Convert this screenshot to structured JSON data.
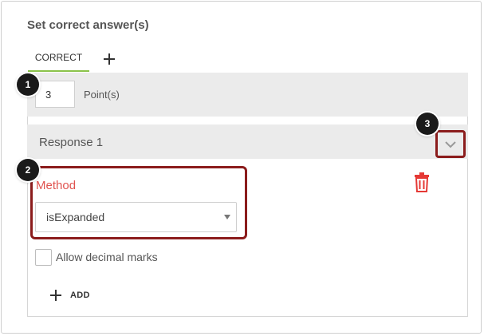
{
  "title": "Set correct answer(s)",
  "tabs": {
    "correct_label": "CORRECT"
  },
  "points": {
    "value": "3",
    "label": "Point(s)"
  },
  "response": {
    "title": "Response 1"
  },
  "method": {
    "label": "Method",
    "selected": "isExpanded"
  },
  "options": {
    "allow_decimal_label": "Allow decimal marks"
  },
  "add_button": {
    "label": "ADD"
  },
  "markers": {
    "one": "1",
    "two": "2",
    "three": "3"
  },
  "colors": {
    "accent_green": "#8bc34a",
    "highlight_red": "#8b1c1c",
    "method_label": "#e0534f",
    "trash": "#e53935"
  },
  "icons": {
    "add_tab": "plus-icon",
    "chevron": "chevron-down-icon",
    "trash": "trash-icon",
    "add": "plus-icon",
    "select": "caret-down-icon"
  }
}
